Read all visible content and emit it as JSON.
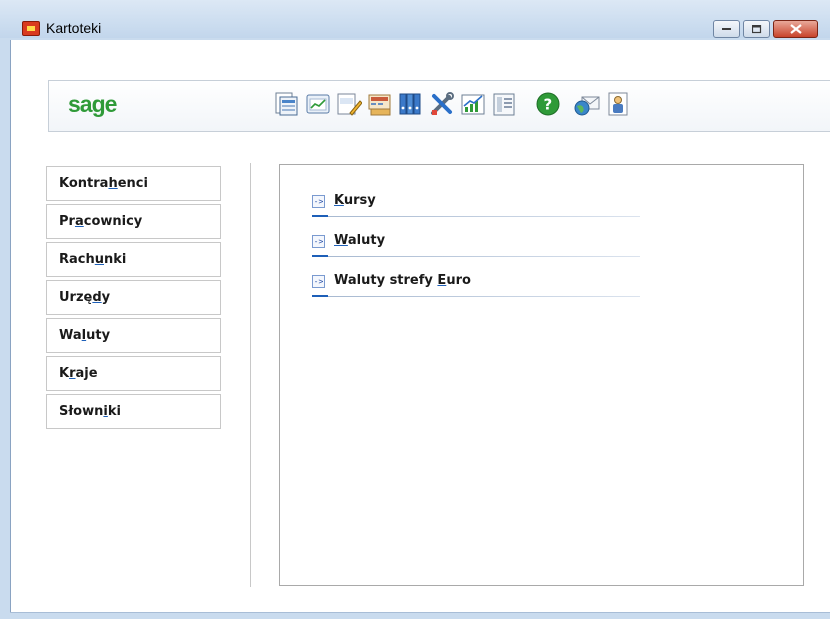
{
  "window": {
    "title": "Kartoteki",
    "controls": {
      "minimize": "minimize-icon",
      "maximize": "maximize-icon",
      "close": "close-icon"
    }
  },
  "toolbar": {
    "logo_text": "sage",
    "icons": [
      "document-list-icon",
      "chart-window-icon",
      "vat-edit-icon",
      "register-calculator-icon",
      "binders-icon",
      "tools-icon",
      "growth-chart-icon",
      "report-list-icon",
      "help-icon",
      "mail-globe-icon",
      "user-card-icon"
    ]
  },
  "sidebar": {
    "items": [
      {
        "label": "Kontrahenci",
        "hotkey_index": 6
      },
      {
        "label": "Pracownicy",
        "hotkey_index": 2
      },
      {
        "label": "Rachunki",
        "hotkey_index": 4
      },
      {
        "label": "Urzędy",
        "hotkey_index": 4
      },
      {
        "label": "Waluty",
        "hotkey_index": 2
      },
      {
        "label": "Kraje",
        "hotkey_index": 1
      },
      {
        "label": "Słowniki",
        "hotkey_index": 5
      }
    ]
  },
  "panel": {
    "links": [
      {
        "label": "Kursy",
        "hotkey_index": 0
      },
      {
        "label": "Waluty",
        "hotkey_index": 0
      },
      {
        "label": "Waluty strefy Euro",
        "hotkey_index": 14
      }
    ]
  },
  "colors": {
    "brand": "#2f9a38",
    "accent": "#1d5fb8",
    "titlebar": "#c9dbee"
  }
}
